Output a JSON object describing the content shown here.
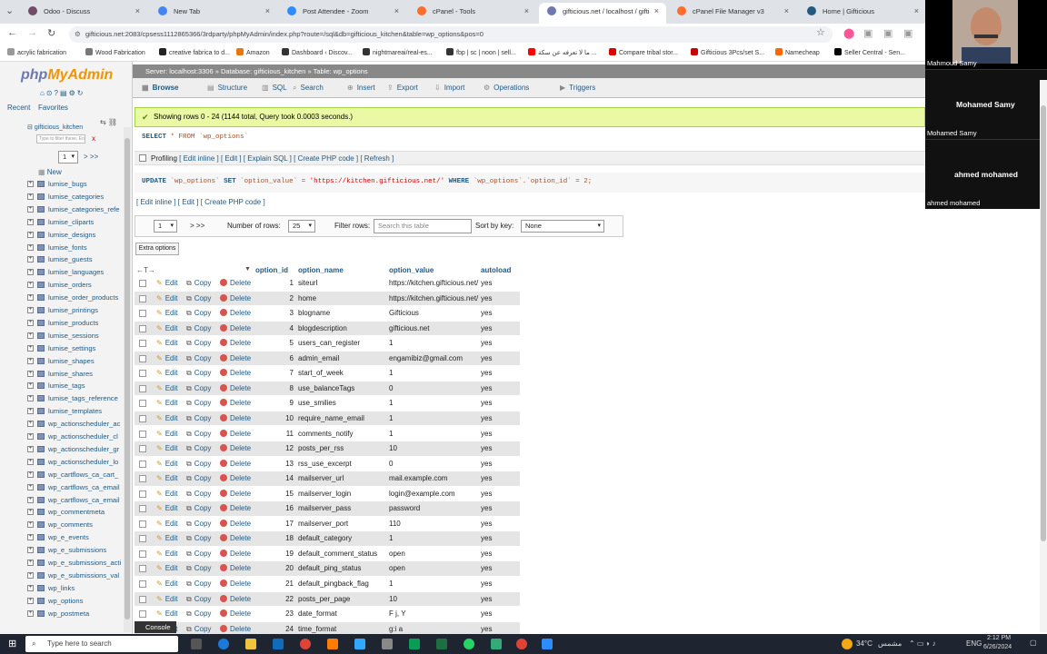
{
  "browser": {
    "tabs": [
      {
        "title": "Odoo - Discuss",
        "color": "#714b67"
      },
      {
        "title": "New Tab",
        "color": "#4285f4"
      },
      {
        "title": "Post Attendee - Zoom",
        "color": "#2d8cff"
      },
      {
        "title": "cPanel - Tools",
        "color": "#ff6c2c"
      },
      {
        "title": "gifticious.net / localhost / gifti",
        "color": "#6c78af"
      },
      {
        "title": "cPanel File Manager v3",
        "color": "#ff6c2c"
      },
      {
        "title": "Home | Gifticious",
        "color": "#235a81"
      }
    ],
    "url": "gifticious.net:2083/cpsess1112865366/3rdparty/phpMyAdmin/index.php?route=/sql&db=gifticious_kitchen&table=wp_options&pos=0",
    "bookmarks": [
      "acrylic fabrication",
      "Wood Fabrication",
      "creative fabrica to d...",
      "Amazon",
      "Dashboard ‹ Discov...",
      "nightmareai/real-es...",
      "fbp | sc | noon | sell...",
      "ما لا تعرفه عن سكة ...",
      "Compare tribal stor...",
      "Gifticious 3Pcs/set S...",
      "Namecheap",
      "Seller Central - Sen..."
    ]
  },
  "participants": [
    {
      "name": "Mahmoud Samy"
    },
    {
      "name": "Mohamed Samy",
      "label": "Mohamed Samy"
    },
    {
      "name": "ahmed mohamed",
      "label": "ahmed mohamed"
    }
  ],
  "sidebar": {
    "logo_a": "php",
    "logo_b": "MyAdmin",
    "recent": "Recent",
    "favorites": "Favorites",
    "db": "gifticious_kitchen",
    "filter_placeholder": "Type to filter these, Enter to search all",
    "filter_clear": "x",
    "page": "1",
    "page_nav": "> >>",
    "new": "New",
    "tables": [
      "lumise_bugs",
      "lumise_categories",
      "lumise_categories_refe",
      "lumise_cliparts",
      "lumise_designs",
      "lumise_fonts",
      "lumise_guests",
      "lumise_languages",
      "lumise_orders",
      "lumise_order_products",
      "lumise_printings",
      "lumise_products",
      "lumise_sessions",
      "lumise_settings",
      "lumise_shapes",
      "lumise_shares",
      "lumise_tags",
      "lumise_tags_reference",
      "lumise_templates",
      "wp_actionscheduler_ac",
      "wp_actionscheduler_cl",
      "wp_actionscheduler_gr",
      "wp_actionscheduler_lo",
      "wp_cartflows_ca_cart_",
      "wp_cartflows_ca_email",
      "wp_cartflows_ca_email",
      "wp_commentmeta",
      "wp_comments",
      "wp_e_events",
      "wp_e_submissions",
      "wp_e_submissions_acti",
      "wp_e_submissions_val",
      "wp_links",
      "wp_options",
      "wp_postmeta"
    ]
  },
  "breadcrumb": {
    "server": "Server: localhost:3306",
    "database": "Database: gifticious_kitchen",
    "table": "Table: wp_options"
  },
  "menu": [
    "Browse",
    "Structure",
    "SQL",
    "Search",
    "Insert",
    "Export",
    "Import",
    "Operations",
    "Triggers"
  ],
  "result": {
    "message": "Showing rows 0 - 24 (1144 total, Query took 0.0003 seconds.)",
    "select_kw": "SELECT",
    "select_rest": "* FROM `wp_options`",
    "profiling": "Profiling",
    "links1": "[ Edit inline ] [ Edit ] [ Explain SQL ] [ Create PHP code ] [ Refresh ]",
    "update_sql_kw1": "UPDATE",
    "update_sql_mid1": "`wp_options`",
    "update_sql_kw2": "SET",
    "update_sql_mid2": "`option_value` =",
    "update_sql_str": "'https://kitchen.gifticious.net/'",
    "update_sql_kw3": "WHERE",
    "update_sql_mid3": "`wp_options`.`option_id` = 2;",
    "links2": "[ Edit inline ] [ Edit ] [ Create PHP code ]"
  },
  "nav": {
    "page": "1",
    "arrows": "> >>",
    "rows_label": "Number of rows:",
    "rows_value": "25",
    "filter_label": "Filter rows:",
    "filter_placeholder": "Search this table",
    "sort_label": "Sort by key:",
    "sort_value": "None",
    "extra": "Extra options"
  },
  "table": {
    "arrows": "←T→",
    "headers": [
      "option_id",
      "option_name",
      "option_value",
      "autoload"
    ],
    "actions": {
      "edit": "Edit",
      "copy": "Copy",
      "delete": "Delete"
    },
    "rows": [
      [
        "1",
        "siteurl",
        "https://kitchen.gifticious.net/",
        "yes"
      ],
      [
        "2",
        "home",
        "https://kitchen.gifticious.net/",
        "yes"
      ],
      [
        "3",
        "blogname",
        "Gifticious",
        "yes"
      ],
      [
        "4",
        "blogdescription",
        "gifticious.net",
        "yes"
      ],
      [
        "5",
        "users_can_register",
        "1",
        "yes"
      ],
      [
        "6",
        "admin_email",
        "engamibiz@gmail.com",
        "yes"
      ],
      [
        "7",
        "start_of_week",
        "1",
        "yes"
      ],
      [
        "8",
        "use_balanceTags",
        "0",
        "yes"
      ],
      [
        "9",
        "use_smilies",
        "1",
        "yes"
      ],
      [
        "10",
        "require_name_email",
        "1",
        "yes"
      ],
      [
        "11",
        "comments_notify",
        "1",
        "yes"
      ],
      [
        "12",
        "posts_per_rss",
        "10",
        "yes"
      ],
      [
        "13",
        "rss_use_excerpt",
        "0",
        "yes"
      ],
      [
        "14",
        "mailserver_url",
        "mail.example.com",
        "yes"
      ],
      [
        "15",
        "mailserver_login",
        "login@example.com",
        "yes"
      ],
      [
        "16",
        "mailserver_pass",
        "password",
        "yes"
      ],
      [
        "17",
        "mailserver_port",
        "110",
        "yes"
      ],
      [
        "18",
        "default_category",
        "1",
        "yes"
      ],
      [
        "19",
        "default_comment_status",
        "open",
        "yes"
      ],
      [
        "20",
        "default_ping_status",
        "open",
        "yes"
      ],
      [
        "21",
        "default_pingback_flag",
        "1",
        "yes"
      ],
      [
        "22",
        "posts_per_page",
        "10",
        "yes"
      ],
      [
        "23",
        "date_format",
        "F j, Y",
        "yes"
      ],
      [
        "24",
        "time_format",
        "g:i a",
        "yes"
      ]
    ]
  },
  "console": "Console",
  "taskbar": {
    "search": "Type here to search",
    "weather": "34°C",
    "weather_desc": "مشمس",
    "lang": "ENG",
    "time": "2:12 PM",
    "date": "6/26/2024"
  }
}
